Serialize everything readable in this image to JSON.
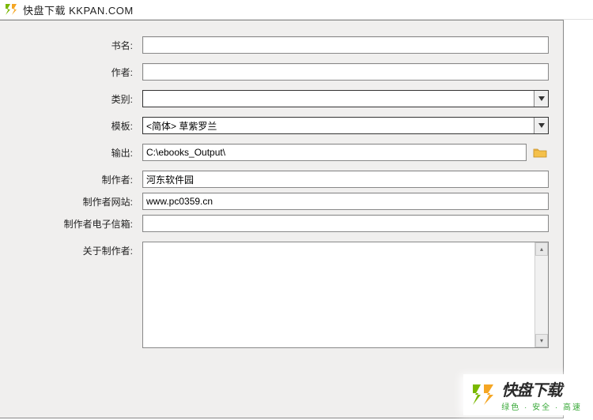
{
  "header": {
    "title": "快盘下载 KKPAN.COM"
  },
  "form": {
    "book_name": {
      "label": "书名:",
      "value": ""
    },
    "author": {
      "label": "作者:",
      "value": ""
    },
    "category": {
      "label": "类别:",
      "selected": ""
    },
    "template": {
      "label": "模板:",
      "selected": "<简体> 草紫罗兰"
    },
    "output": {
      "label": "输出:",
      "value": "C:\\ebooks_Output\\"
    },
    "creator": {
      "label": "制作者:",
      "value": "河东软件园"
    },
    "website": {
      "label": "制作者网站:",
      "value": "www.pc0359.cn"
    },
    "email": {
      "label": "制作者电子信箱:",
      "value": ""
    },
    "about": {
      "label": "关于制作者:",
      "value": ""
    }
  },
  "watermark": {
    "main": "快盘下载",
    "sub": "绿色 · 安全 · 高速"
  }
}
